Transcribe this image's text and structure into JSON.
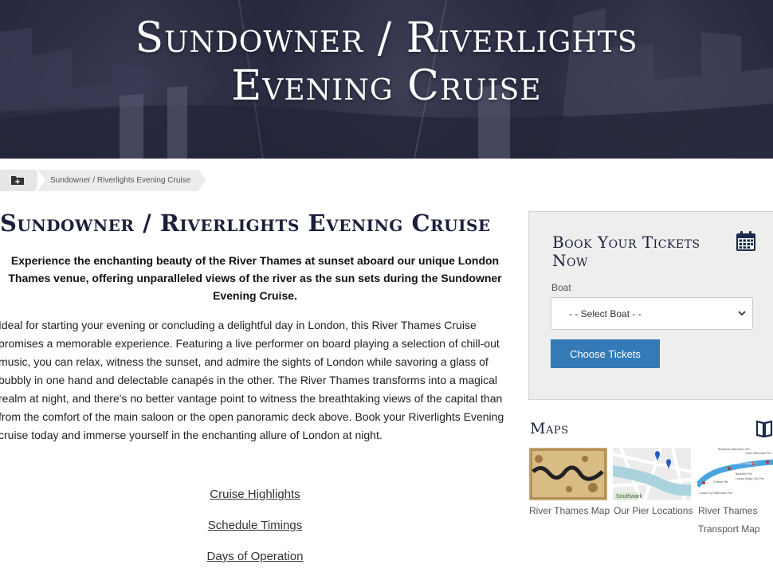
{
  "hero": {
    "title_line1": "Sundowner / Riverlights",
    "title_line2": "Evening Cruise"
  },
  "breadcrumb": {
    "current": "Sundowner / Riverlights Evening Cruise"
  },
  "main": {
    "title": "Sundowner / Riverlights Evening Cruise",
    "intro": "Experience the enchanting beauty of the River Thames at sunset aboard our unique London Thames venue, offering unparalleled views of the river as the sun sets during the Sundowner Evening Cruise.",
    "body": "Ideal for starting your evening or concluding a delightful day in London, this River Thames Cruise promises a memorable experience. Featuring a live performer on board playing a selection of chill-out music, you can relax, witness the sunset, and admire the sights of London while savoring a glass of bubbly in one hand and delectable canapés in the other. The River Thames transforms into a magical realm at night, and there's no better vantage point to witness the breathtaking views of the capital than from the comfort of the main saloon or the open panoramic deck above. Book your Riverlights Evening cruise today and immerse yourself in the enchanting allure of London at night.",
    "links": [
      "Cruise Highlights",
      "Schedule Timings",
      "Days of Operation"
    ]
  },
  "booking": {
    "title": "Book Your Tickets Now",
    "boat_label": "Boat",
    "boat_select": "- - Select Boat - -",
    "button": "Choose Tickets"
  },
  "maps": {
    "title": "Maps",
    "items": [
      {
        "caption": "River Thames Map"
      },
      {
        "caption": "Our Pier Locations",
        "labels": [
          "Southwark"
        ]
      },
      {
        "caption": "River Thames Transport Map",
        "labels": [
          "Blackfriars Millennium Pier",
          "Tower Millennium Pier",
          "Bankside Pier",
          "London Bridge City Pier",
          "London Eye Millennium Pier",
          "Festival Pier",
          "RIVER THAMES"
        ]
      }
    ]
  },
  "colors": {
    "accent": "#337ab7",
    "title": "#1b1f3a",
    "panel": "#eeeeee"
  }
}
